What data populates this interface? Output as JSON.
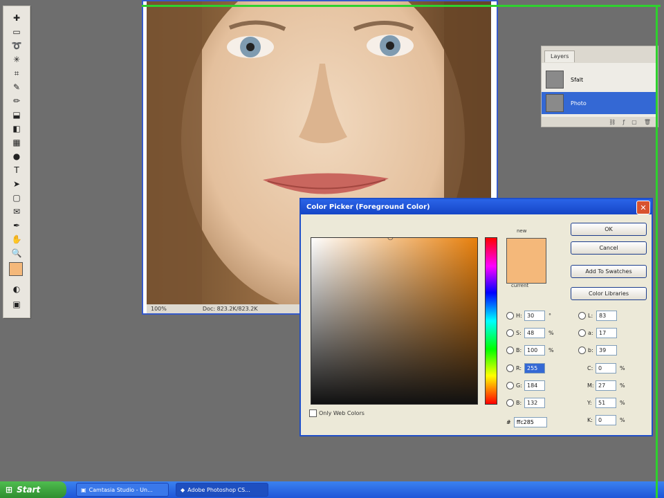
{
  "document": {
    "zoom": "100%",
    "doc_size": "Doc: 823.2K/823.2K"
  },
  "layers_panel": {
    "tab_label": "Layers",
    "layers": [
      {
        "name": "Sfalt"
      },
      {
        "name": "Photo",
        "selected": true
      }
    ]
  },
  "color_picker": {
    "title": "Color Picker (Foreground Color)",
    "buttons": {
      "ok": "OK",
      "cancel": "Cancel",
      "add_to_swatches": "Add To Swatches",
      "color_libraries": "Color Libraries"
    },
    "new_label": "new",
    "current_label": "current",
    "only_web_colors": "Only Web Colors",
    "fields": {
      "H": "30",
      "S": "48",
      "B": "100",
      "R": "255",
      "G": "184",
      "Bv": "132",
      "L": "83",
      "a": "17",
      "b": "39",
      "C": "0",
      "M": "27",
      "Y": "51",
      "K": "0"
    },
    "units": {
      "deg": "°",
      "pct": "%"
    },
    "hex": "ffc285",
    "swatch_color": "#f4b87a"
  },
  "taskbar": {
    "start_label": "Start",
    "tasks": [
      {
        "label": "Camtasia Studio - Un..."
      },
      {
        "label": "Adobe Photoshop CS..."
      }
    ]
  }
}
